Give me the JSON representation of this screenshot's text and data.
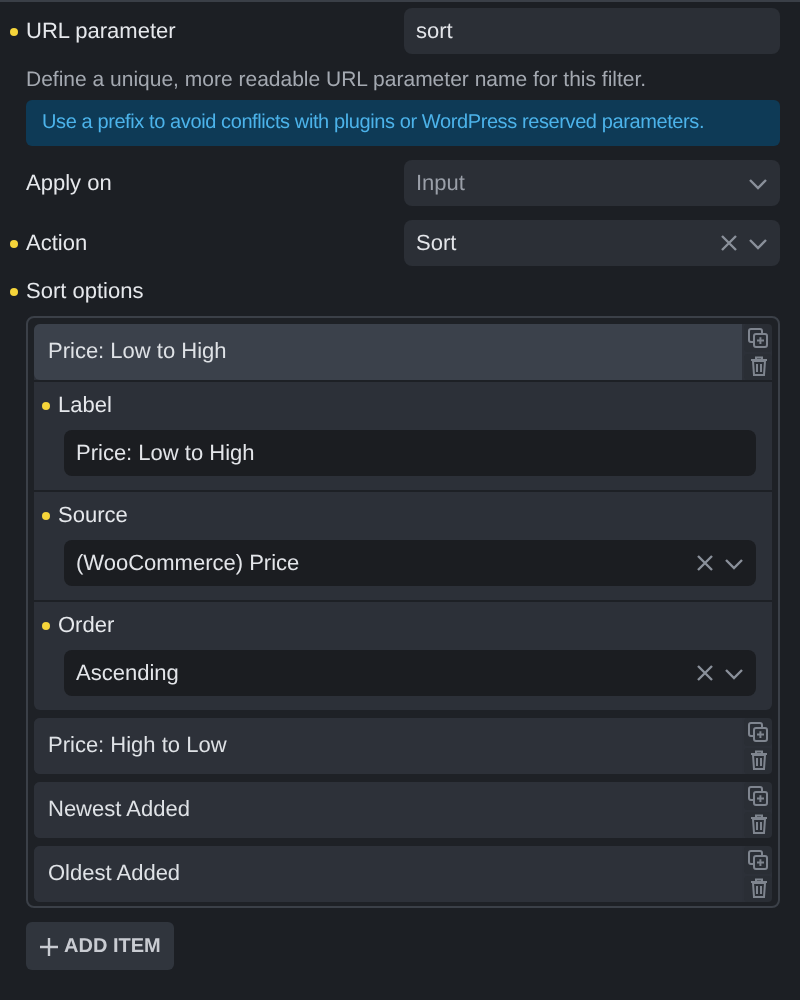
{
  "fields": [
    {
      "kind": "text",
      "label": "URL parameter",
      "required": true,
      "value": "sort",
      "description": "Define a unique, more readable URL parameter name for this filter.",
      "notice": "Use a prefix to avoid conflicts with plugins or WordPress reserved parameters."
    },
    {
      "kind": "select",
      "label": "Apply on",
      "required": false,
      "placeholder": "Input",
      "clearable": false
    },
    {
      "kind": "select",
      "label": "Action",
      "required": true,
      "value": "Sort",
      "clearable": true
    }
  ],
  "sort_options": {
    "label": "Sort options",
    "required": true,
    "items": [
      {
        "title": "Price: Low to High",
        "expanded": true,
        "fields": [
          {
            "kind": "text",
            "label": "Label",
            "required": true,
            "value": "Price: Low to High"
          },
          {
            "kind": "select",
            "label": "Source",
            "required": true,
            "value": "(WooCommerce) Price",
            "clearable": true
          },
          {
            "kind": "select",
            "label": "Order",
            "required": true,
            "value": "Ascending",
            "clearable": true
          }
        ]
      },
      {
        "title": "Price: High to Low",
        "expanded": false
      },
      {
        "title": "Newest Added",
        "expanded": false
      },
      {
        "title": "Oldest Added",
        "expanded": false
      }
    ]
  },
  "add_button": "ADD ITEM"
}
